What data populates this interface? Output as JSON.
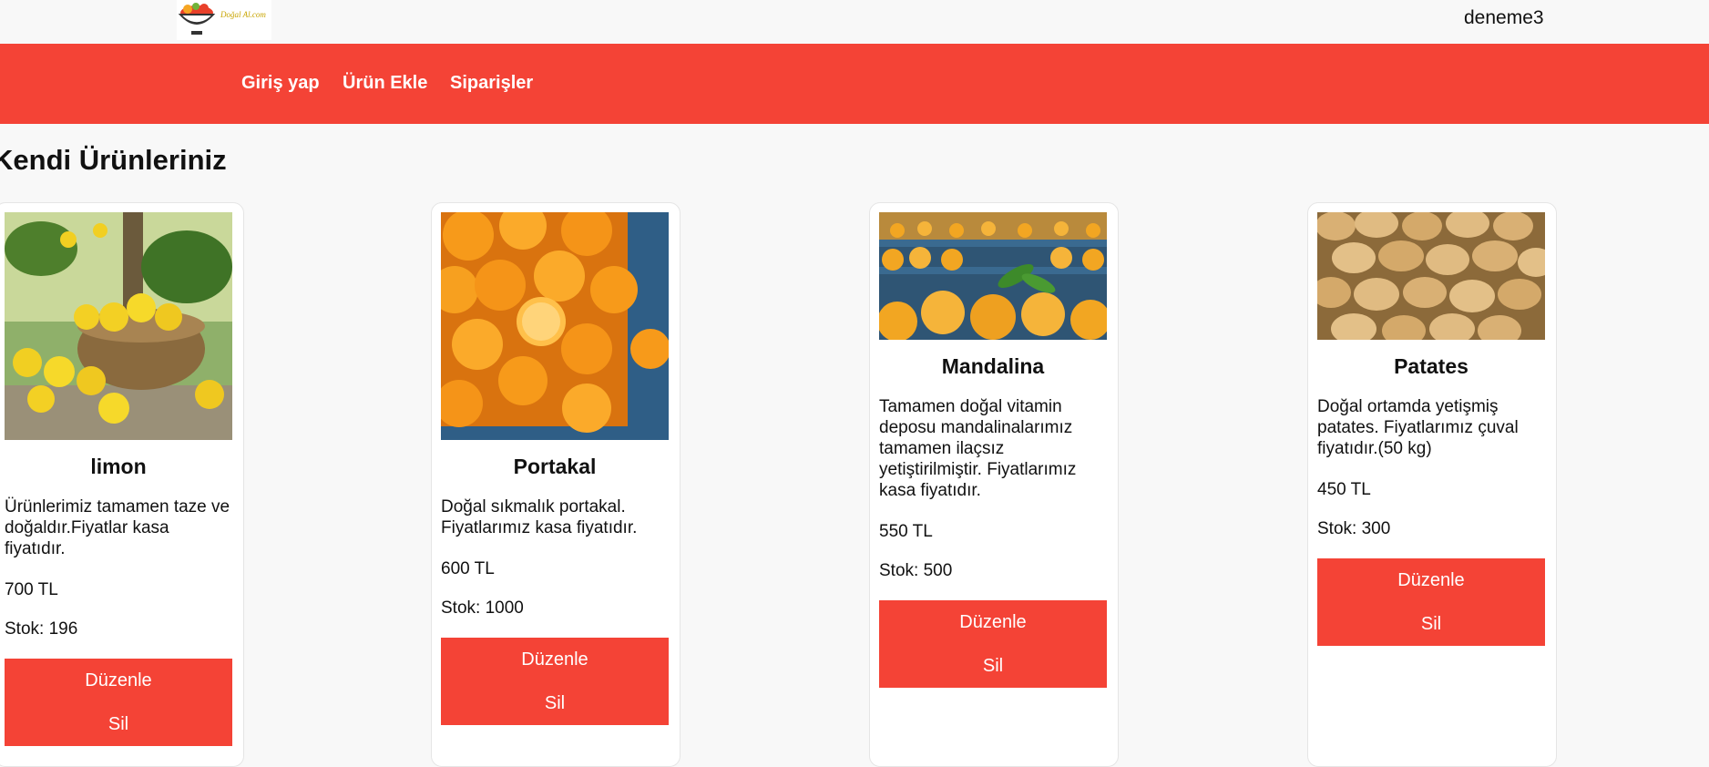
{
  "header": {
    "logo_text": "Doğal Al.com",
    "username": "deneme3"
  },
  "nav": {
    "items": [
      {
        "label": "Giriş yap"
      },
      {
        "label": "Ürün Ekle"
      },
      {
        "label": "Siparişler"
      }
    ]
  },
  "main": {
    "title": "Kendi Ürünleriniz",
    "products": [
      {
        "name": "limon",
        "description": "Ürünlerimiz tamamen taze ve doğaldır.Fiyatlar kasa fiyatıdır.",
        "price": "700 TL",
        "stock": "Stok: 196",
        "edit_label": "Düzenle",
        "delete_label": "Sil"
      },
      {
        "name": "Portakal",
        "description": "Doğal sıkmalık portakal. Fiyatlarımız kasa fiyatıdır.",
        "price": "600 TL",
        "stock": "Stok: 1000",
        "edit_label": "Düzenle",
        "delete_label": "Sil"
      },
      {
        "name": "Mandalina",
        "description": "Tamamen doğal vitamin deposu mandalinalarımız tamamen ilaçsız yetiştirilmiştir. Fiyatlarımız kasa fiyatıdır.",
        "price": "550 TL",
        "stock": "Stok: 500",
        "edit_label": "Düzenle",
        "delete_label": "Sil"
      },
      {
        "name": "Patates",
        "description": "Doğal ortamda yetişmiş patates. Fiyatlarımız çuval fiyatıdır.(50 kg)",
        "price": "450 TL",
        "stock": "Stok: 300",
        "edit_label": "Düzenle",
        "delete_label": "Sil"
      }
    ]
  }
}
